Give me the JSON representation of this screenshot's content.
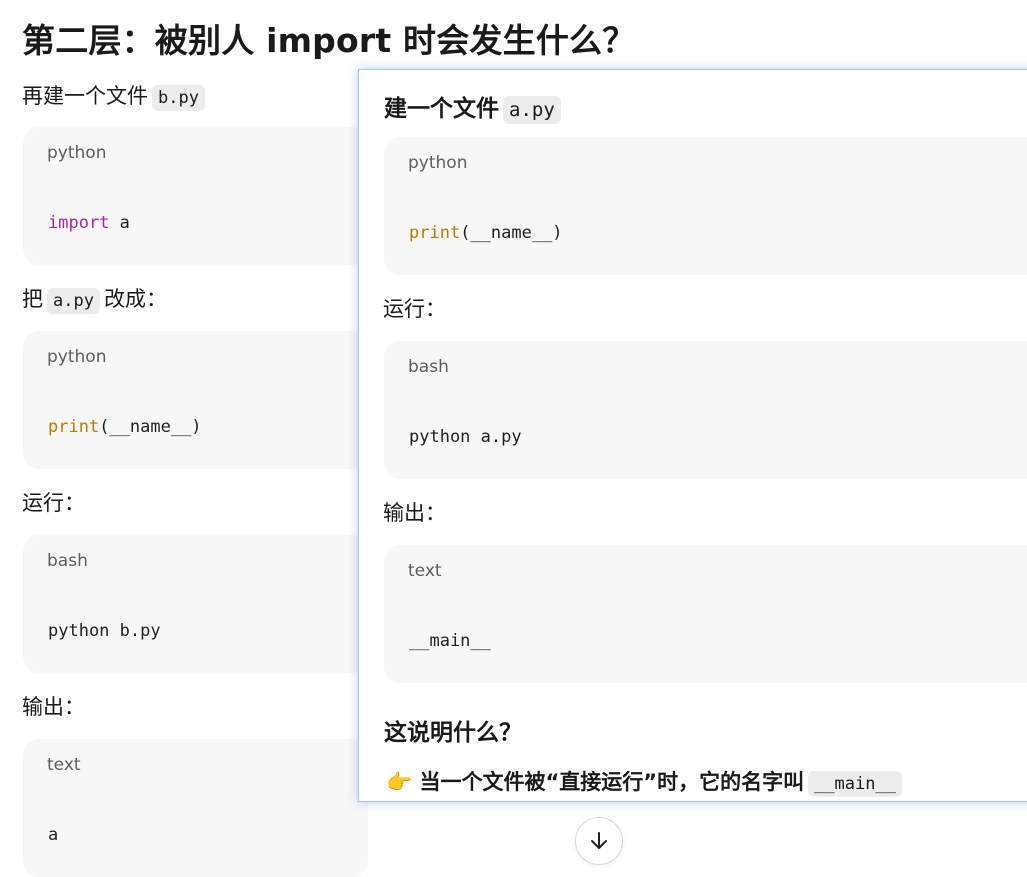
{
  "heading": "第二层：被别人 import 时会发生什么？",
  "left": {
    "p1_text": "再建一个文件",
    "p1_code": "b.py",
    "block1": {
      "lang": "python",
      "kw": "import",
      "rest": " a"
    },
    "p2_pre": "把",
    "p2_code": "a.py",
    "p2_post": "改成：",
    "block2": {
      "lang": "python",
      "fn": "print",
      "rest": "(__name__)"
    },
    "p3": "运行：",
    "block3": {
      "lang": "bash",
      "code": "python b.py"
    },
    "p4": "输出：",
    "block4": {
      "lang": "text",
      "code": "a"
    }
  },
  "panel": {
    "title_text": "建一个文件",
    "title_code": "a.py",
    "block1": {
      "lang": "python",
      "fn": "print",
      "rest": "(__name__)"
    },
    "p1": "运行：",
    "block2": {
      "lang": "bash",
      "code": "python a.py"
    },
    "p2": "输出：",
    "block3": {
      "lang": "text",
      "code": "__main__"
    },
    "subheading": "这说明什么？",
    "bullet_icon": "👉",
    "bullet_text": "当一个文件被“直接运行”时，它的名字叫",
    "bullet_code": "__main__"
  },
  "scroll_button": {
    "icon": "arrow-down-icon"
  }
}
